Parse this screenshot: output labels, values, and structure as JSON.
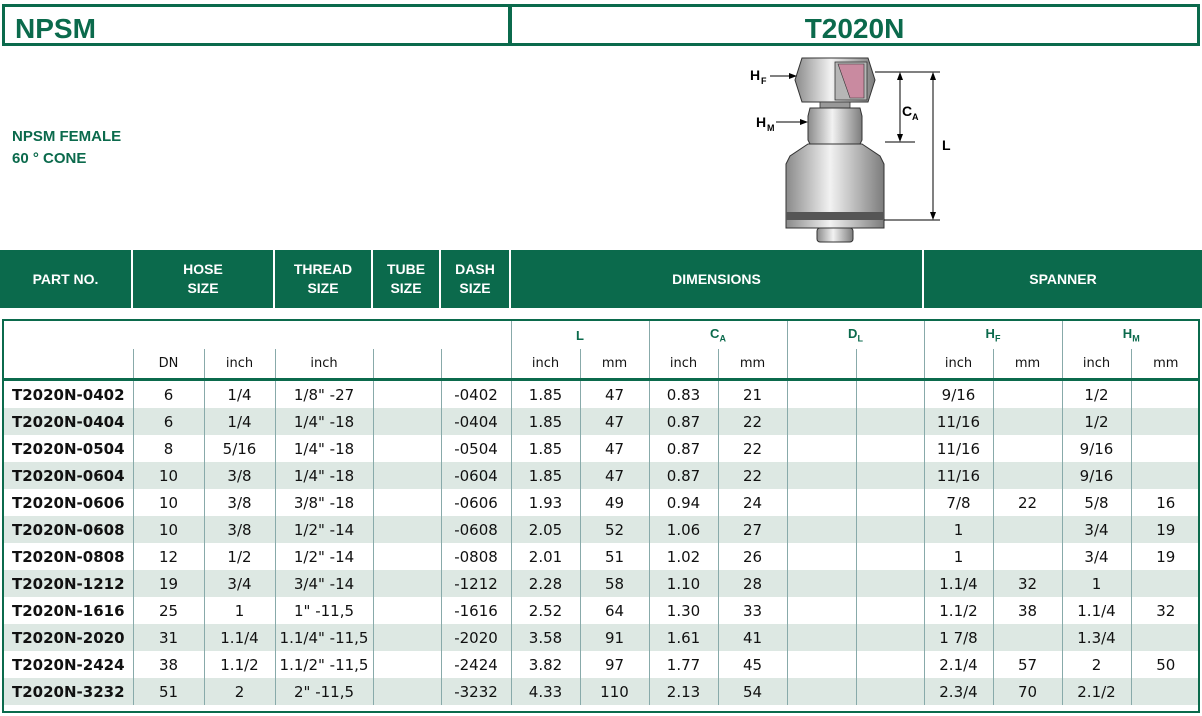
{
  "header": {
    "left_title": "NPSM",
    "right_title": "T2020N"
  },
  "description": {
    "line1": "NPSM  FEMALE",
    "line2": "60 ° CONE"
  },
  "figure": {
    "label_hf": "H",
    "label_hf_sub": "F",
    "label_hm": "H",
    "label_hm_sub": "M",
    "label_ca": "C",
    "label_ca_sub": "A",
    "label_l": "L"
  },
  "columns": {
    "part_no": "PART NO.",
    "hose_size": [
      "HOSE",
      "SIZE"
    ],
    "thread_size": [
      "THREAD",
      "SIZE"
    ],
    "tube_size": [
      "TUBE",
      "SIZE"
    ],
    "dash_size": [
      "DASH",
      "SIZE"
    ],
    "dimensions": "DIMENSIONS",
    "spanner": "SPANNER"
  },
  "sub_headers": {
    "L": "L",
    "CA": "C",
    "CA_sub": "A",
    "DL": "D",
    "DL_sub": "L",
    "HF": "H",
    "HF_sub": "F",
    "HM": "H",
    "HM_sub": "M",
    "dn": "DN",
    "inch": "inch",
    "mm": "mm"
  },
  "rows": [
    {
      "part": "T2020N-0402",
      "dn": "6",
      "hose_inch": "1/4",
      "thread": "1/8\" -27",
      "tube": "",
      "dash": "-0402",
      "l_in": "1.85",
      "l_mm": "47",
      "ca_in": "0.83",
      "ca_mm": "21",
      "dl_in": "",
      "dl_mm": "",
      "hf_in": "9/16",
      "hf_mm": "",
      "hm_in": "1/2",
      "hm_mm": ""
    },
    {
      "part": "T2020N-0404",
      "dn": "6",
      "hose_inch": "1/4",
      "thread": "1/4\" -18",
      "tube": "",
      "dash": "-0404",
      "l_in": "1.85",
      "l_mm": "47",
      "ca_in": "0.87",
      "ca_mm": "22",
      "dl_in": "",
      "dl_mm": "",
      "hf_in": "11/16",
      "hf_mm": "",
      "hm_in": "1/2",
      "hm_mm": ""
    },
    {
      "part": "T2020N-0504",
      "dn": "8",
      "hose_inch": "5/16",
      "thread": "1/4\" -18",
      "tube": "",
      "dash": "-0504",
      "l_in": "1.85",
      "l_mm": "47",
      "ca_in": "0.87",
      "ca_mm": "22",
      "dl_in": "",
      "dl_mm": "",
      "hf_in": "11/16",
      "hf_mm": "",
      "hm_in": "9/16",
      "hm_mm": ""
    },
    {
      "part": "T2020N-0604",
      "dn": "10",
      "hose_inch": "3/8",
      "thread": "1/4\" -18",
      "tube": "",
      "dash": "-0604",
      "l_in": "1.85",
      "l_mm": "47",
      "ca_in": "0.87",
      "ca_mm": "22",
      "dl_in": "",
      "dl_mm": "",
      "hf_in": "11/16",
      "hf_mm": "",
      "hm_in": "9/16",
      "hm_mm": ""
    },
    {
      "part": "T2020N-0606",
      "dn": "10",
      "hose_inch": "3/8",
      "thread": "3/8\" -18",
      "tube": "",
      "dash": "-0606",
      "l_in": "1.93",
      "l_mm": "49",
      "ca_in": "0.94",
      "ca_mm": "24",
      "dl_in": "",
      "dl_mm": "",
      "hf_in": "7/8",
      "hf_mm": "22",
      "hm_in": "5/8",
      "hm_mm": "16"
    },
    {
      "part": "T2020N-0608",
      "dn": "10",
      "hose_inch": "3/8",
      "thread": "1/2\" -14",
      "tube": "",
      "dash": "-0608",
      "l_in": "2.05",
      "l_mm": "52",
      "ca_in": "1.06",
      "ca_mm": "27",
      "dl_in": "",
      "dl_mm": "",
      "hf_in": "1",
      "hf_mm": "",
      "hm_in": "3/4",
      "hm_mm": "19"
    },
    {
      "part": "T2020N-0808",
      "dn": "12",
      "hose_inch": "1/2",
      "thread": "1/2\" -14",
      "tube": "",
      "dash": "-0808",
      "l_in": "2.01",
      "l_mm": "51",
      "ca_in": "1.02",
      "ca_mm": "26",
      "dl_in": "",
      "dl_mm": "",
      "hf_in": "1",
      "hf_mm": "",
      "hm_in": "3/4",
      "hm_mm": "19"
    },
    {
      "part": "T2020N-1212",
      "dn": "19",
      "hose_inch": "3/4",
      "thread": "3/4\" -14",
      "tube": "",
      "dash": "-1212",
      "l_in": "2.28",
      "l_mm": "58",
      "ca_in": "1.10",
      "ca_mm": "28",
      "dl_in": "",
      "dl_mm": "",
      "hf_in": "1.1/4",
      "hf_mm": "32",
      "hm_in": "1",
      "hm_mm": ""
    },
    {
      "part": "T2020N-1616",
      "dn": "25",
      "hose_inch": "1",
      "thread": "1\" -11,5",
      "tube": "",
      "dash": "-1616",
      "l_in": "2.52",
      "l_mm": "64",
      "ca_in": "1.30",
      "ca_mm": "33",
      "dl_in": "",
      "dl_mm": "",
      "hf_in": "1.1/2",
      "hf_mm": "38",
      "hm_in": "1.1/4",
      "hm_mm": "32"
    },
    {
      "part": "T2020N-2020",
      "dn": "31",
      "hose_inch": "1.1/4",
      "thread": "1.1/4\" -11,5",
      "tube": "",
      "dash": "-2020",
      "l_in": "3.58",
      "l_mm": "91",
      "ca_in": "1.61",
      "ca_mm": "41",
      "dl_in": "",
      "dl_mm": "",
      "hf_in": "1  7/8",
      "hf_mm": "",
      "hm_in": "1.3/4",
      "hm_mm": ""
    },
    {
      "part": "T2020N-2424",
      "dn": "38",
      "hose_inch": "1.1/2",
      "thread": "1.1/2\" -11,5",
      "tube": "",
      "dash": "-2424",
      "l_in": "3.82",
      "l_mm": "97",
      "ca_in": "1.77",
      "ca_mm": "45",
      "dl_in": "",
      "dl_mm": "",
      "hf_in": "2.1/4",
      "hf_mm": "57",
      "hm_in": "2",
      "hm_mm": "50"
    },
    {
      "part": "T2020N-3232",
      "dn": "51",
      "hose_inch": "2",
      "thread": "2\" -11,5",
      "tube": "",
      "dash": "-3232",
      "l_in": "4.33",
      "l_mm": "110",
      "ca_in": "2.13",
      "ca_mm": "54",
      "dl_in": "",
      "dl_mm": "",
      "hf_in": "2.3/4",
      "hf_mm": "70",
      "hm_in": "2.1/2",
      "hm_mm": ""
    }
  ]
}
